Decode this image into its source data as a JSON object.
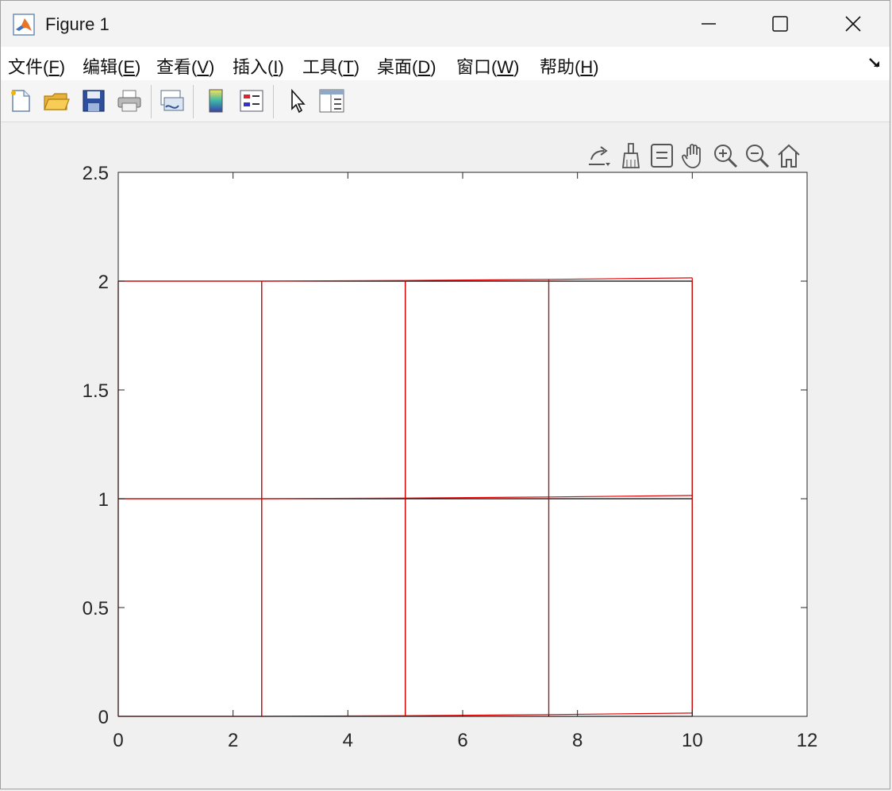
{
  "window": {
    "title": "Figure 1"
  },
  "menubar": {
    "items": [
      {
        "label": "文件(",
        "key": "F",
        "tail": ")"
      },
      {
        "label": "编辑(",
        "key": "E",
        "tail": ")"
      },
      {
        "label": "查看(",
        "key": "V",
        "tail": ")"
      },
      {
        "label": "插入(",
        "key": "I",
        "tail": ")"
      },
      {
        "label": "工具(",
        "key": "T",
        "tail": ")"
      },
      {
        "label": "桌面(",
        "key": "D",
        "tail": ")"
      },
      {
        "label": "窗口(",
        "key": "W",
        "tail": ")"
      },
      {
        "label": "帮助(",
        "key": "H",
        "tail": ")"
      }
    ]
  },
  "toolbar": {
    "icons": [
      "new-file-icon",
      "open-folder-icon",
      "save-icon",
      "print-icon",
      "link-plot-icon",
      "colorbar-icon",
      "legend-icon",
      "pointer-icon",
      "property-inspector-icon"
    ]
  },
  "axes_toolbar": {
    "icons": [
      "export-icon",
      "brush-icon",
      "data-tips-icon",
      "pan-icon",
      "zoom-in-icon",
      "zoom-out-icon",
      "home-icon"
    ]
  },
  "colors": {
    "mesh_original": "#000000",
    "mesh_deformed": "#e00000",
    "axes": "#262626"
  },
  "chart_data": {
    "type": "line",
    "title": "",
    "xlabel": "",
    "ylabel": "",
    "xlim": [
      0,
      12
    ],
    "ylim": [
      0,
      2.5
    ],
    "xticks": [
      "0",
      "2",
      "4",
      "6",
      "8",
      "10",
      "12"
    ],
    "yticks": [
      "0",
      "0.5",
      "1",
      "1.5",
      "2",
      "2.5"
    ],
    "grid": false,
    "series": [
      {
        "color": "#000000",
        "segments": [
          [
            [
              0,
              0
            ],
            [
              10,
              0
            ]
          ],
          [
            [
              0,
              1
            ],
            [
              10,
              1
            ]
          ],
          [
            [
              0,
              2
            ],
            [
              10,
              2
            ]
          ],
          [
            [
              0,
              0
            ],
            [
              0,
              2
            ]
          ],
          [
            [
              2.5,
              0
            ],
            [
              2.5,
              2
            ]
          ],
          [
            [
              5,
              0
            ],
            [
              5,
              2
            ]
          ],
          [
            [
              7.5,
              0
            ],
            [
              7.5,
              2
            ]
          ],
          [
            [
              10,
              0
            ],
            [
              10,
              2
            ]
          ]
        ]
      },
      {
        "color": "#e00000",
        "segments": [
          [
            [
              0,
              0
            ],
            [
              2.5,
              0
            ],
            [
              5,
              0.003
            ],
            [
              7.5,
              0.008
            ],
            [
              10,
              0.015
            ]
          ],
          [
            [
              0,
              1
            ],
            [
              2.5,
              1
            ],
            [
              5,
              1.003
            ],
            [
              7.5,
              1.008
            ],
            [
              10,
              1.015
            ]
          ],
          [
            [
              0,
              2
            ],
            [
              2.5,
              2
            ],
            [
              5,
              2.003
            ],
            [
              7.5,
              2.008
            ],
            [
              10,
              2.015
            ]
          ],
          [
            [
              0,
              0
            ],
            [
              0,
              2
            ]
          ],
          [
            [
              2.5,
              0
            ],
            [
              2.5,
              2
            ]
          ],
          [
            [
              5,
              0.003
            ],
            [
              5,
              2.003
            ]
          ],
          [
            [
              7.5,
              0.008
            ],
            [
              7.5,
              2.008
            ]
          ],
          [
            [
              10,
              0.015
            ],
            [
              10,
              2.015
            ]
          ]
        ]
      }
    ]
  }
}
